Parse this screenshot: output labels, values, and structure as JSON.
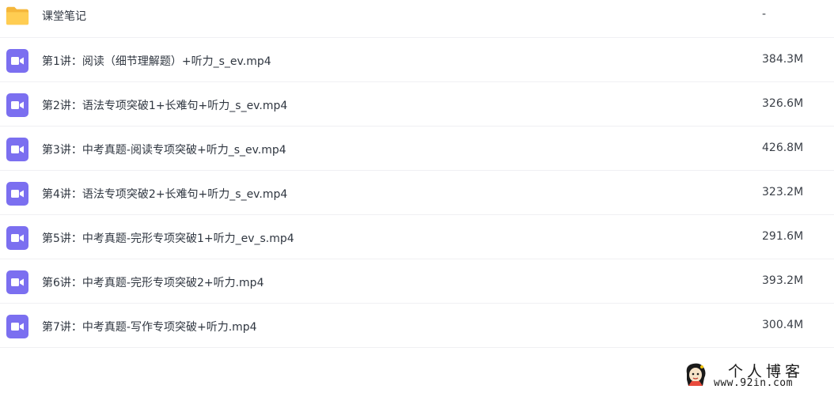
{
  "files": [
    {
      "type": "folder",
      "icon": "folder-icon",
      "name": "课堂笔记",
      "size": "-"
    },
    {
      "type": "video",
      "icon": "video-icon",
      "name": "第1讲：阅读（细节理解题）+听力_s_ev.mp4",
      "size": "384.3M"
    },
    {
      "type": "video",
      "icon": "video-icon",
      "name": "第2讲：语法专项突破1+长难句+听力_s_ev.mp4",
      "size": "326.6M"
    },
    {
      "type": "video",
      "icon": "video-icon",
      "name": "第3讲：中考真题-阅读专项突破+听力_s_ev.mp4",
      "size": "426.8M"
    },
    {
      "type": "video",
      "icon": "video-icon",
      "name": "第4讲：语法专项突破2+长难句+听力_s_ev.mp4",
      "size": "323.2M"
    },
    {
      "type": "video",
      "icon": "video-icon",
      "name": "第5讲：中考真题-完形专项突破1+听力_ev_s.mp4",
      "size": "291.6M"
    },
    {
      "type": "video",
      "icon": "video-icon",
      "name": "第6讲：中考真题-完形专项突破2+听力.mp4",
      "size": "393.2M"
    },
    {
      "type": "video",
      "icon": "video-icon",
      "name": "第7讲：中考真题-写作专项突破+听力.mp4",
      "size": "300.4M"
    }
  ],
  "watermark": {
    "title": "个人博客",
    "url": "www.92in.com"
  },
  "colors": {
    "folder": "#ffc94d",
    "video_badge": "#7b6ff0",
    "divider": "#f0f0f3",
    "text": "#2f3640"
  }
}
